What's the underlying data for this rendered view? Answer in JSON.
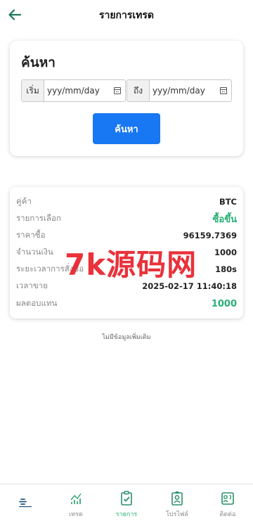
{
  "header": {
    "title": "รายการเทรด",
    "back_icon": "arrow-left-icon"
  },
  "search": {
    "title": "ค้นหา",
    "from_label": "เริ่ม",
    "from_placeholder": "yyy/mm/day",
    "to_label": "ถึง",
    "to_placeholder": "yyy/mm/day",
    "button_label": "ค้นหา"
  },
  "trade": {
    "rows": [
      {
        "label": "คู่ค้า",
        "value": "BTC"
      },
      {
        "label": "รายการเลือก",
        "value": "ซื้อขึ้น"
      },
      {
        "label": "ราคาซื้อ",
        "value": "96159.7369"
      },
      {
        "label": "จำนวนเงิน",
        "value": "1000"
      },
      {
        "label": "ระยะเวลาการสั่งซื้อ",
        "value": "180s"
      },
      {
        "label": "เวลาขาย",
        "value": "2025-02-17 11:40:18"
      },
      {
        "label": "ผลตอบแทน",
        "value": "1000"
      }
    ]
  },
  "watermark": "7k源码网",
  "footer_note": "ไม่มีข้อมูลเพิ่มเติม",
  "nav": {
    "items": [
      {
        "label": "",
        "icon": "logo-icon"
      },
      {
        "label": "เทรด",
        "icon": "chart-icon"
      },
      {
        "label": "รายการ",
        "icon": "clipboard-check-icon"
      },
      {
        "label": "โปรไฟล์",
        "icon": "profile-badge-icon"
      },
      {
        "label": "ติดต่อ",
        "icon": "contact-icon"
      }
    ]
  },
  "colors": {
    "accent": "#27ae74",
    "button": "#1877f2",
    "watermark": "#e8232d"
  }
}
